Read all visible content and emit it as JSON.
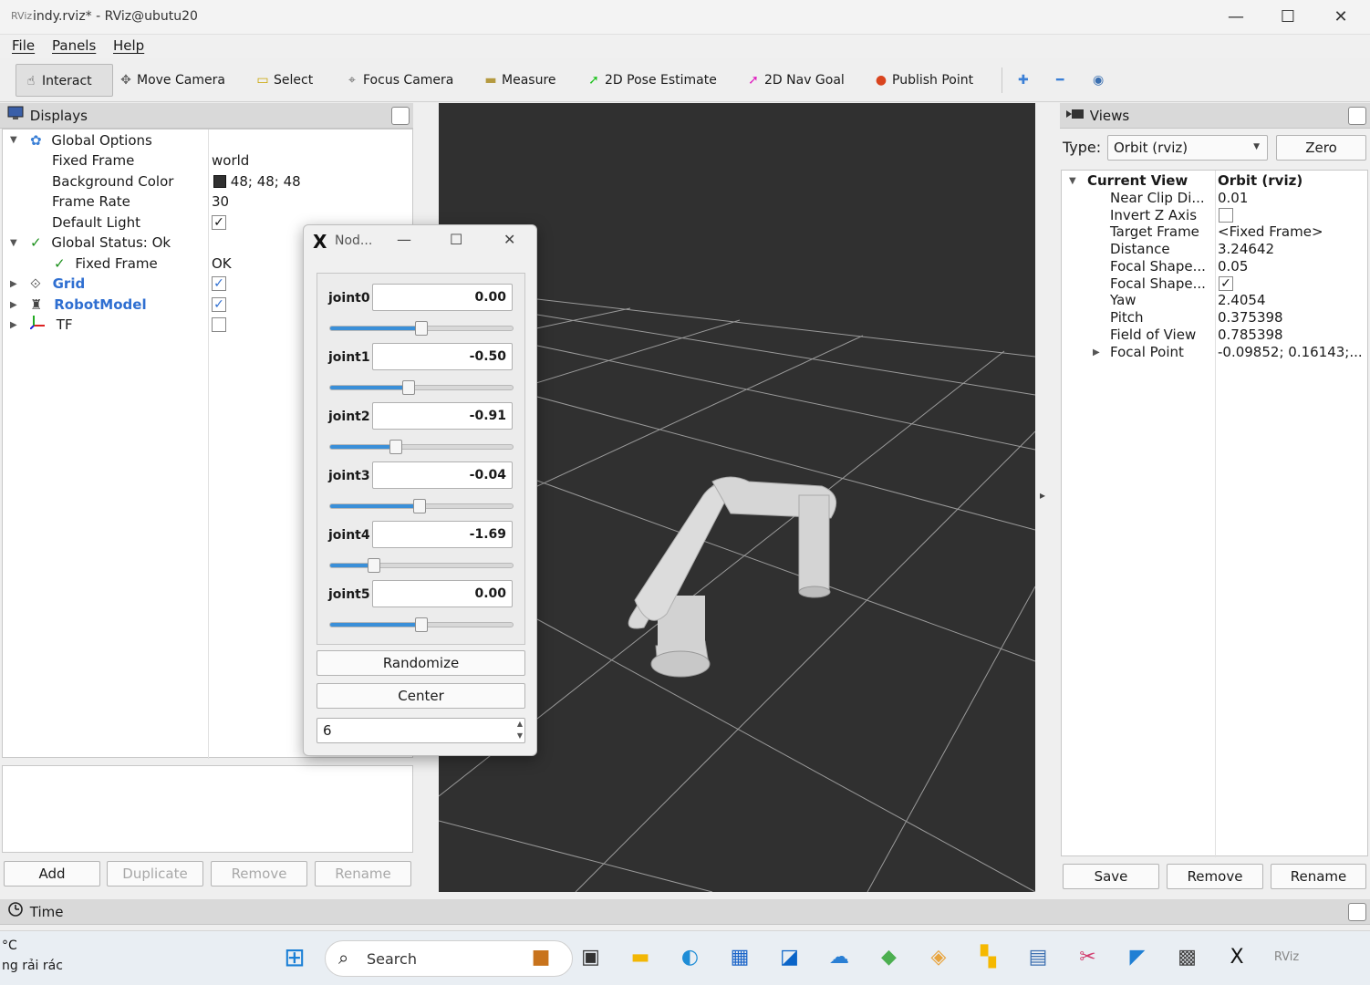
{
  "window": {
    "title": "indy.rviz* - RViz@ubutu20",
    "app_icon_label": "RViz",
    "minimize_symbol": "—",
    "maximize_symbol": "☐",
    "close_symbol": "✕"
  },
  "menu": [
    "File",
    "Panels",
    "Help"
  ],
  "toolbar": {
    "tools": [
      {
        "label": "Interact",
        "icon": "hand-icon",
        "glyph": "☝",
        "color": "#333333"
      },
      {
        "label": "Move Camera",
        "icon": "move-camera-icon",
        "glyph": "✥",
        "color": "#666666"
      },
      {
        "label": "Select",
        "icon": "select-icon",
        "glyph": "▭",
        "color": "#c9a400"
      },
      {
        "label": "Focus Camera",
        "icon": "focus-camera-icon",
        "glyph": "⌖",
        "color": "#666666"
      },
      {
        "label": "Measure",
        "icon": "measure-icon",
        "glyph": "▬",
        "color": "#b59a40"
      },
      {
        "label": "2D Pose Estimate",
        "icon": "pose-estimate-arrow-icon",
        "glyph": "➚",
        "color": "#22c322"
      },
      {
        "label": "2D Nav Goal",
        "icon": "nav-goal-arrow-icon",
        "glyph": "➚",
        "color": "#e020c0"
      },
      {
        "label": "Publish Point",
        "icon": "map-pin-icon",
        "glyph": "●",
        "color": "#d9441e"
      }
    ],
    "add_tool_symbol": "✚",
    "remove_tool_symbol": "━",
    "view_symbol": "◉"
  },
  "displays": {
    "header": "Displays",
    "rows": [
      {
        "label": "Global Options",
        "value": ""
      },
      {
        "label": "Fixed Frame",
        "value": "world"
      },
      {
        "label": "Background Color",
        "value": "48; 48; 48"
      },
      {
        "label": "Frame Rate",
        "value": "30"
      },
      {
        "label": "Default Light",
        "value": "✓"
      },
      {
        "label": "Global Status: Ok",
        "value": ""
      },
      {
        "label": "Fixed Frame",
        "value": "OK"
      },
      {
        "label": "Grid",
        "value": "✓"
      },
      {
        "label": "RobotModel",
        "value": "✓"
      },
      {
        "label": "TF",
        "value": ""
      }
    ],
    "background_color_swatch": "#303030",
    "check_symbol": "✓",
    "buttons": {
      "add": "Add",
      "duplicate": "Duplicate",
      "remove": "Remove",
      "rename": "Rename"
    }
  },
  "joint_dialog": {
    "title": "Nod...",
    "x_logo": "X",
    "joints": [
      {
        "name": "joint0",
        "value": "0.00",
        "slider_fraction": 0.5
      },
      {
        "name": "joint1",
        "value": "-0.50",
        "slider_fraction": 0.43
      },
      {
        "name": "joint2",
        "value": "-0.91",
        "slider_fraction": 0.36
      },
      {
        "name": "joint3",
        "value": "-0.04",
        "slider_fraction": 0.49
      },
      {
        "name": "joint4",
        "value": "-1.69",
        "slider_fraction": 0.24
      },
      {
        "name": "joint5",
        "value": "0.00",
        "slider_fraction": 0.5
      }
    ],
    "randomize": "Randomize",
    "center": "Center",
    "spin_value": "6",
    "spin_up": "▲",
    "spin_down": "▼"
  },
  "views": {
    "header": "Views",
    "type_label": "Type:",
    "type_value": "Orbit (rviz)",
    "zero": "Zero",
    "dropdown_symbol": "▼",
    "rows": [
      {
        "label": "Current View",
        "value": "Orbit (rviz)"
      },
      {
        "label": "Near Clip Di...",
        "value": "0.01"
      },
      {
        "label": "Invert Z Axis",
        "value": ""
      },
      {
        "label": "Target Frame",
        "value": "<Fixed Frame>"
      },
      {
        "label": "Distance",
        "value": "3.24642"
      },
      {
        "label": "Focal Shape...",
        "value": "0.05"
      },
      {
        "label": "Focal Shape...",
        "value": "✓"
      },
      {
        "label": "Yaw",
        "value": "2.4054"
      },
      {
        "label": "Pitch",
        "value": "0.375398"
      },
      {
        "label": "Field of View",
        "value": "0.785398"
      },
      {
        "label": "Focal Point",
        "value": "-0.09852; 0.16143;..."
      }
    ],
    "buttons": {
      "save": "Save",
      "remove": "Remove",
      "rename": "Rename"
    }
  },
  "time_panel": {
    "header": "Time"
  },
  "splitter_arrow": "▸",
  "taskbar": {
    "left_text_1": "°C",
    "left_text_2": "ng rải rác",
    "search_placeholder": "Search",
    "start_glyph": "⊞",
    "search_glyph": "⌕",
    "apps": [
      {
        "name": "briefcase-icon",
        "glyph": "■",
        "color": "#c8731c"
      },
      {
        "name": "task-view-icon",
        "glyph": "▣",
        "color": "#333333"
      },
      {
        "name": "file-explorer-icon",
        "glyph": "▬",
        "color": "#f2b705"
      },
      {
        "name": "edge-icon",
        "glyph": "◐",
        "color": "#1f8dd6"
      },
      {
        "name": "store-icon",
        "glyph": "▦",
        "color": "#1a64c8"
      },
      {
        "name": "outlook-icon",
        "glyph": "◪",
        "color": "#0a64c8"
      },
      {
        "name": "cloud-icon",
        "glyph": "☁",
        "color": "#2a7fd4"
      },
      {
        "name": "layers-icon",
        "glyph": "◆",
        "color": "#4caf50"
      },
      {
        "name": "git-icon",
        "glyph": "◈",
        "color": "#e8a33c"
      },
      {
        "name": "pixel-app-icon",
        "glyph": "▚",
        "color": "#f5b800"
      },
      {
        "name": "notes-icon",
        "glyph": "▤",
        "color": "#3c6fb0"
      },
      {
        "name": "snipping-icon",
        "glyph": "✂",
        "color": "#d23c6e"
      },
      {
        "name": "vscode-icon",
        "glyph": "◤",
        "color": "#1f7fd4"
      },
      {
        "name": "terminal-icon",
        "glyph": "▩",
        "color": "#444444"
      },
      {
        "name": "xlaunch-icon",
        "glyph": "X",
        "color": "#111111"
      },
      {
        "name": "rviz-icon",
        "glyph": "RViz",
        "color": "#888888"
      }
    ]
  }
}
